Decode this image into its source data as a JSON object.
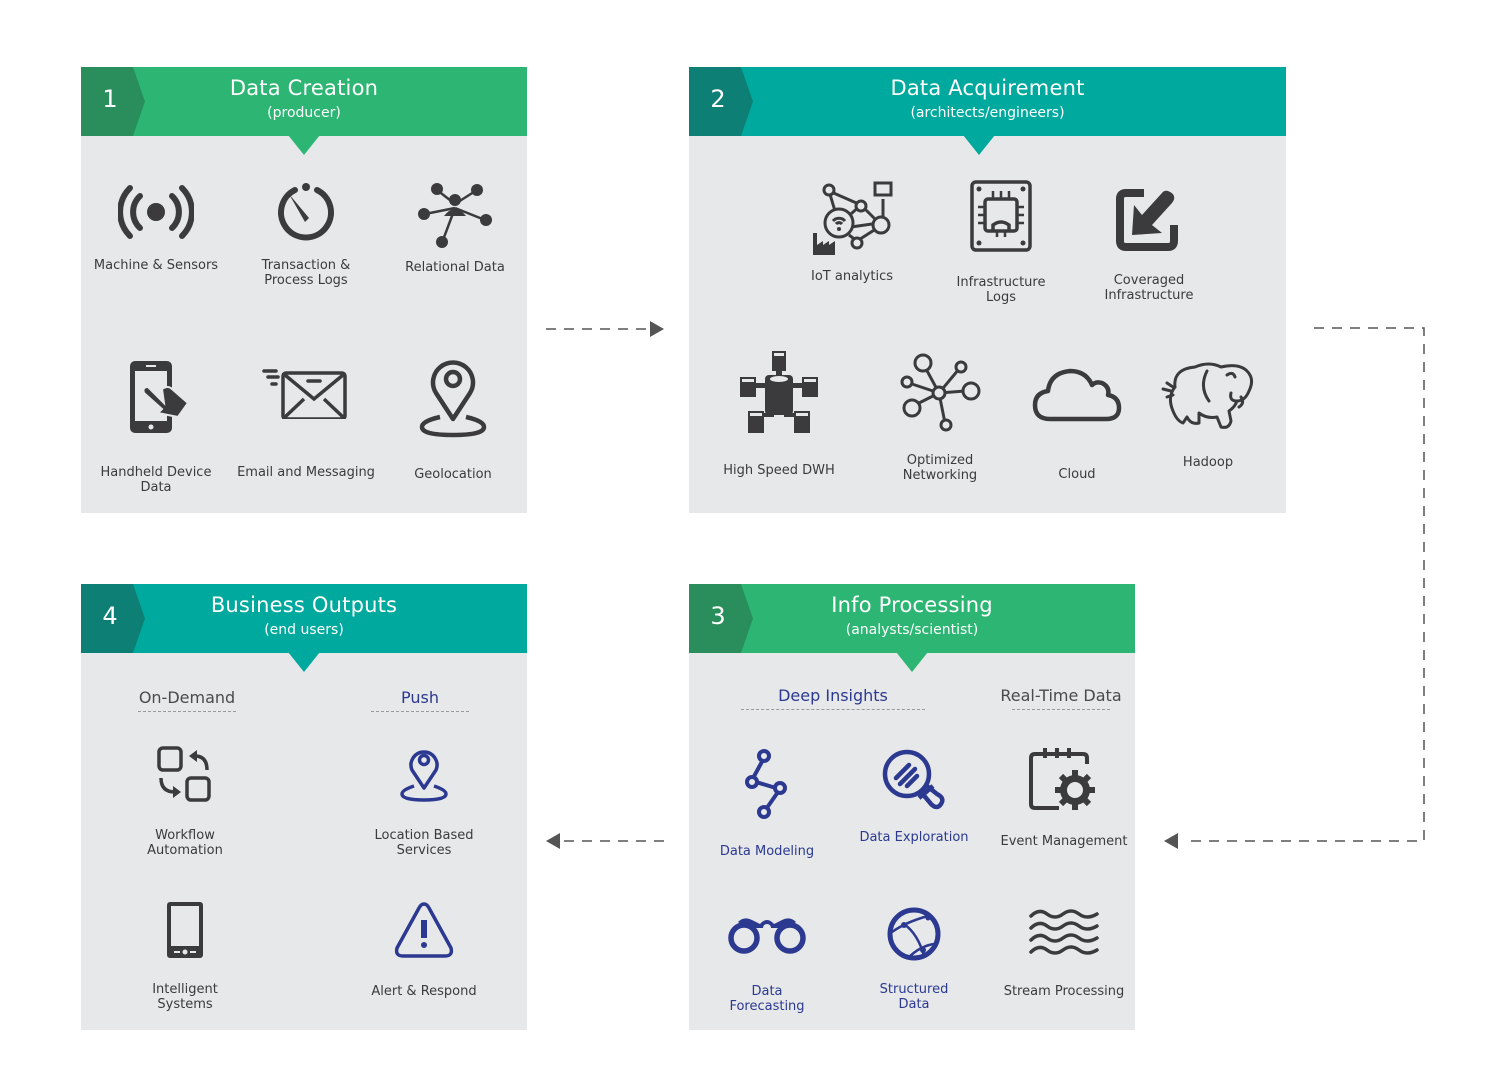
{
  "colors": {
    "green": "#2db673",
    "green_dark": "#2a8e5c",
    "teal": "#00a99d",
    "teal_dark": "#0e7f75",
    "panel_bg": "#e7e8ea",
    "icon_dark": "#3b3b3d",
    "icon_blue": "#2b3990",
    "connector": "#555555"
  },
  "panels": [
    {
      "number": "1",
      "title": "Data Creation",
      "subtitle": "(producer)",
      "items": [
        {
          "label": "Machine & Sensors",
          "icon": "wireless-signal-icon"
        },
        {
          "label": "Transaction & Process Logs",
          "icon": "timer-gauge-icon"
        },
        {
          "label": "Relational Data",
          "icon": "user-network-icon"
        },
        {
          "label": "Handheld Device Data",
          "icon": "phone-touch-icon"
        },
        {
          "label": "Email and Messaging",
          "icon": "envelope-send-icon"
        },
        {
          "label": "Geolocation",
          "icon": "map-pin-icon"
        }
      ]
    },
    {
      "number": "2",
      "title": "Data Acquirement",
      "subtitle": "(architects/engineers)",
      "items": [
        {
          "label": "IoT analytics",
          "icon": "iot-network-icon"
        },
        {
          "label": "Infrastructure Logs",
          "icon": "chip-board-icon"
        },
        {
          "label": "Coveraged Infrastructure",
          "icon": "import-arrow-icon"
        },
        {
          "label": "High Speed DWH",
          "icon": "database-cluster-icon"
        },
        {
          "label": "Optimized Networking",
          "icon": "network-nodes-icon"
        },
        {
          "label": "Cloud",
          "icon": "cloud-icon"
        },
        {
          "label": "Hadoop",
          "icon": "elephant-icon"
        }
      ]
    },
    {
      "number": "3",
      "title": "Info Processing",
      "subtitle": "(analysts/scientist)",
      "categories": [
        "Deep Insights",
        "Real-Time Data"
      ],
      "items": [
        {
          "label": "Data Modeling",
          "icon": "node-path-icon"
        },
        {
          "label": "Data Exploration",
          "icon": "magnifier-icon"
        },
        {
          "label": "Event Management",
          "icon": "calendar-gear-icon"
        },
        {
          "label": "Data Forecasting",
          "icon": "binoculars-icon"
        },
        {
          "label": "Structured Data",
          "icon": "globe-icon"
        },
        {
          "label": "Stream Processing",
          "icon": "waves-icon"
        }
      ]
    },
    {
      "number": "4",
      "title": "Business Outputs",
      "subtitle": "(end users)",
      "categories": [
        "On-Demand",
        "Push"
      ],
      "items": [
        {
          "label": "Workflow Automation",
          "icon": "workflow-swap-icon"
        },
        {
          "label": "Location Based Services",
          "icon": "location-pin-icon"
        },
        {
          "label": "Intelligent Systems",
          "icon": "tablet-icon"
        },
        {
          "label": "Alert & Respond",
          "icon": "warning-triangle-icon"
        }
      ]
    }
  ]
}
